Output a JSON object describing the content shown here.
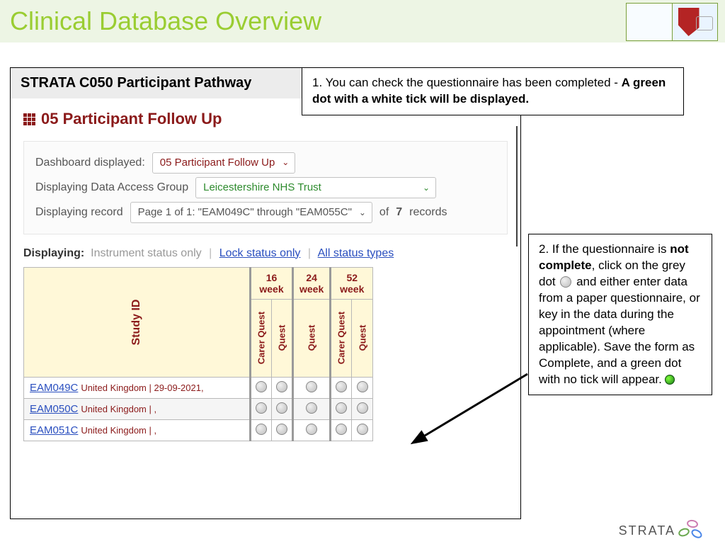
{
  "slide": {
    "title": "Clinical Database Overview"
  },
  "app": {
    "title": "STRATA C050 Participant Pathway",
    "section": "05 Participant Follow Up",
    "filters": {
      "dashboard_label": "Dashboard displayed:",
      "dashboard_value": "05 Participant Follow Up",
      "dag_label": "Displaying Data Access Group",
      "dag_value": "Leicestershire NHS Trust",
      "record_label": "Displaying record",
      "record_value": "Page 1 of 1: \"EAM049C\" through \"EAM055C\"",
      "record_suffix_of": "of",
      "record_count": "7",
      "record_suffix_records": "records"
    },
    "displaying": {
      "label": "Displaying:",
      "instrument": "Instrument status only",
      "lock": "Lock status only",
      "all": "All status types"
    },
    "table": {
      "studyid_head": "Study ID",
      "groups": [
        "16 week",
        "24 week",
        "52 week"
      ],
      "cols_g1": [
        "Carer Quest",
        "Quest"
      ],
      "cols_g2": [
        "Quest"
      ],
      "cols_g3": [
        "Carer Quest",
        "Quest"
      ],
      "rows": [
        {
          "id": "EAM049C",
          "meta": "United Kingdom | 29-09-2021,"
        },
        {
          "id": "EAM050C",
          "meta": "United Kingdom | ,"
        },
        {
          "id": "EAM051C",
          "meta": "United Kingdom | ,"
        }
      ]
    }
  },
  "callout1": {
    "pre": "1. You can check the questionnaire has been completed - ",
    "bold": "A green dot with a white tick will be displayed."
  },
  "callout2": {
    "t1": "2. If the questionnaire is ",
    "b1": "not complete",
    "t2": ", click on the grey dot ",
    "t3": " and either enter data from a paper questionnaire, or key in the data during the appointment (where applicable). Save the form as Complete, and a green dot with no tick will appear."
  },
  "footer": {
    "brand": "STRATA"
  }
}
